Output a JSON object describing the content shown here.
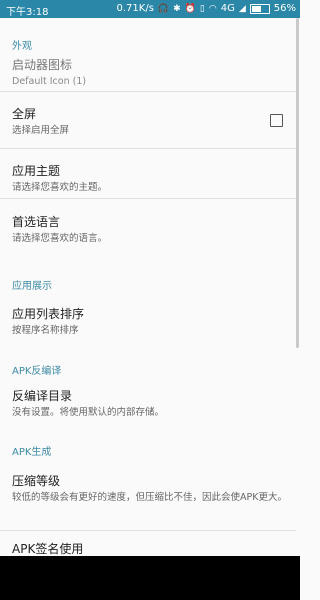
{
  "status_bar": {
    "time": "下午3:18",
    "network_speed": "0.71K/s",
    "network_type": "4G",
    "battery": "56%",
    "battery_level": 0.56,
    "icons": [
      "headset-icon",
      "bluetooth-icon",
      "alarm-icon",
      "vibrate-icon",
      "wifi-icon",
      "signal-icon",
      "battery-icon"
    ]
  },
  "sections": {
    "appearance": {
      "header": "外观",
      "launcher_icon": {
        "title": "启动器图标",
        "summary": "Default Icon (1)"
      },
      "fullscreen": {
        "title": "全屏",
        "summary": "选择启用全屏",
        "checked": false
      },
      "theme": {
        "title": "应用主题",
        "summary": "请选择您喜欢的主题。"
      },
      "language": {
        "title": "首选语言",
        "summary": "请选择您喜欢的语言。"
      }
    },
    "app_display": {
      "header": "应用展示",
      "sort": {
        "title": "应用列表排序",
        "summary": "按程序名称排序"
      }
    },
    "apk_decompile": {
      "header": "APK反编译",
      "output_dir": {
        "title": "反编译目录",
        "summary": "没有设置。将使用默认的内部存储。"
      }
    },
    "apk_build": {
      "header": "APK生成",
      "compression": {
        "title": "压缩等级",
        "summary": "较低的等级会有更好的速度，但压缩比不佳，因此会使APK更大。"
      },
      "signing": {
        "title": "APK签名使用"
      }
    }
  },
  "colors": {
    "status_bar": "#2a87a8",
    "section_header": "#3d8ba6",
    "background": "#fafafa"
  }
}
